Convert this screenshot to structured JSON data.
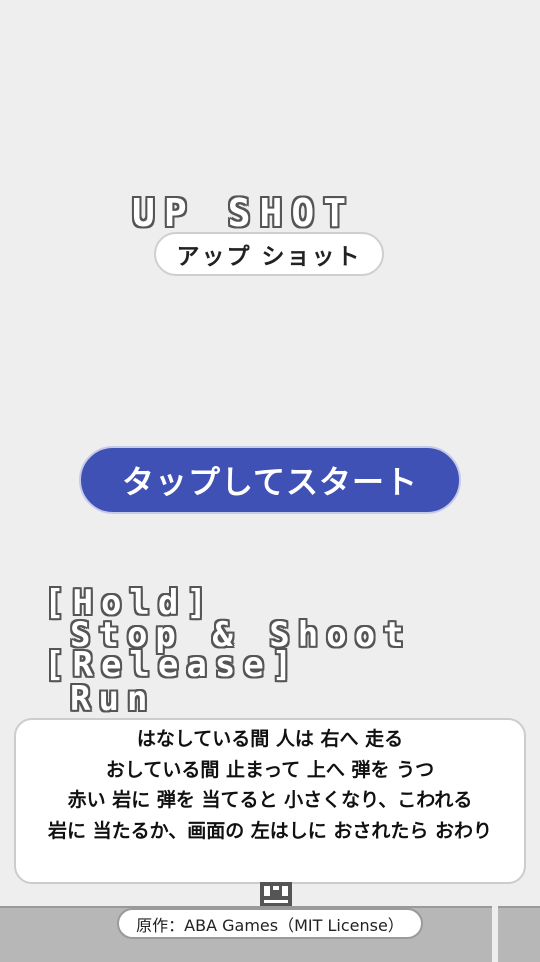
{
  "game": {
    "title": "UP SHOT",
    "subtitle": "アップ ショット",
    "start_label": "タップしてスタート"
  },
  "controls": {
    "hold": "[Hold]",
    "hold_action": "Stop & Shoot",
    "release": "[Release]",
    "release_action": "Run"
  },
  "instructions": {
    "lines": [
      "はなしている間 人は 右へ 走る",
      "おしている間 止まって 上へ 弾を うつ",
      "赤い 岩に 弾を 当てると 小さくなり、こわれる",
      "岩に 当たるか、画面の 左はしに おされたら おわり"
    ]
  },
  "credit": "原作：ABA Games（MIT License）",
  "colors": {
    "background": "#eeeeee",
    "start_button": "#3f51b5",
    "ground": "#b7b7b7",
    "pixel_outline": "#555555"
  }
}
